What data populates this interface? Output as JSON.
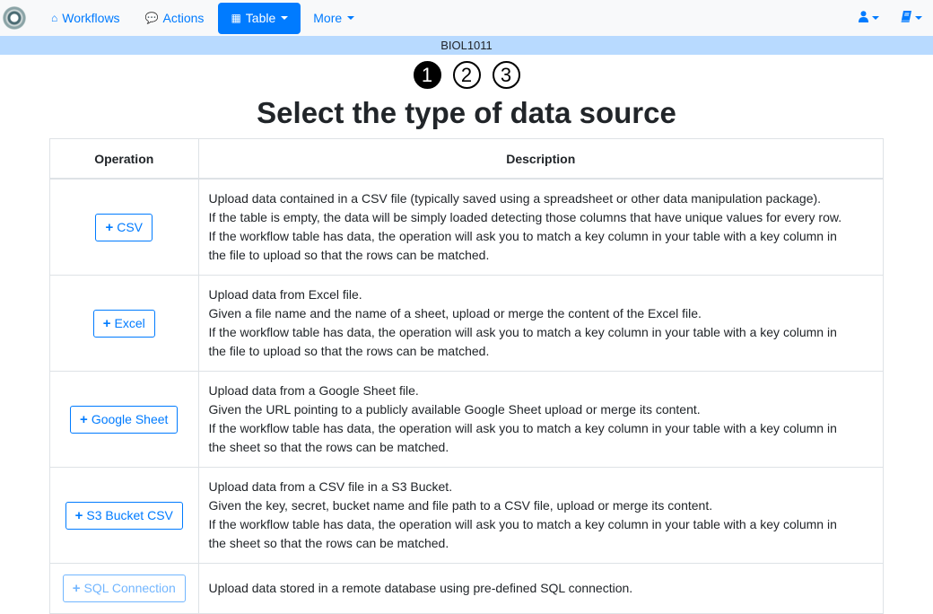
{
  "navbar": {
    "logo": "ontask-logo",
    "items": [
      {
        "label": "Workflows",
        "icon": "home-icon",
        "glyph": "⌂"
      },
      {
        "label": "Actions",
        "icon": "comments-icon",
        "glyph": "💬"
      },
      {
        "label": "Table",
        "icon": "table-icon",
        "glyph": "▦",
        "active": true,
        "dropdown": true
      },
      {
        "label": "More",
        "dropdown": true
      }
    ],
    "right": [
      {
        "icon": "user-icon",
        "glyph": "👤"
      },
      {
        "icon": "book-icon",
        "glyph": "📘"
      }
    ]
  },
  "course": "BIOL1011",
  "steps": [
    "1",
    "2",
    "3"
  ],
  "current_step": 1,
  "title": "Select the type of data source",
  "table": {
    "headers": [
      "Operation",
      "Description"
    ],
    "rows": [
      {
        "button": "CSV",
        "lines": [
          "Upload data contained in a CSV file (typically saved using a spreadsheet or other data manipulation package).",
          "If the table is empty, the data will be simply loaded detecting those columns that have unique values for every row.",
          "If the workflow table has data, the operation will ask you to match a key column in your table with a key column in",
          "the file to upload so that the rows can be matched."
        ]
      },
      {
        "button": "Excel",
        "lines": [
          "Upload data from Excel file.",
          "Given a file name and the name of a sheet, upload or merge the content of the Excel file.",
          "If the workflow table has data, the operation will ask you to match a key column in your table with a key column in",
          "the file to upload so that the rows can be matched."
        ]
      },
      {
        "button": "Google Sheet",
        "lines": [
          "Upload data from a Google Sheet file.",
          "Given the URL pointing to a publicly available Google Sheet upload or merge its content.",
          "If the workflow table has data, the operation will ask you to match a key column in your table with a key column in",
          "the sheet so that the rows can be matched."
        ]
      },
      {
        "button": "S3 Bucket CSV",
        "lines": [
          "Upload data from a CSV file in a S3 Bucket.",
          "Given the key, secret, bucket name and file path to a CSV file, upload or merge its content.",
          "If the workflow table has data, the operation will ask you to match a key column in your table with a key column in",
          "the sheet so that the rows can be matched."
        ]
      },
      {
        "button": "SQL Connection",
        "disabled": true,
        "lines": [
          "Upload data stored in a remote database using pre-defined SQL connection."
        ]
      }
    ]
  },
  "colors": {
    "primary": "#007bff",
    "course_bar": "#b8daff",
    "navbar_bg": "#f8f9fa"
  }
}
